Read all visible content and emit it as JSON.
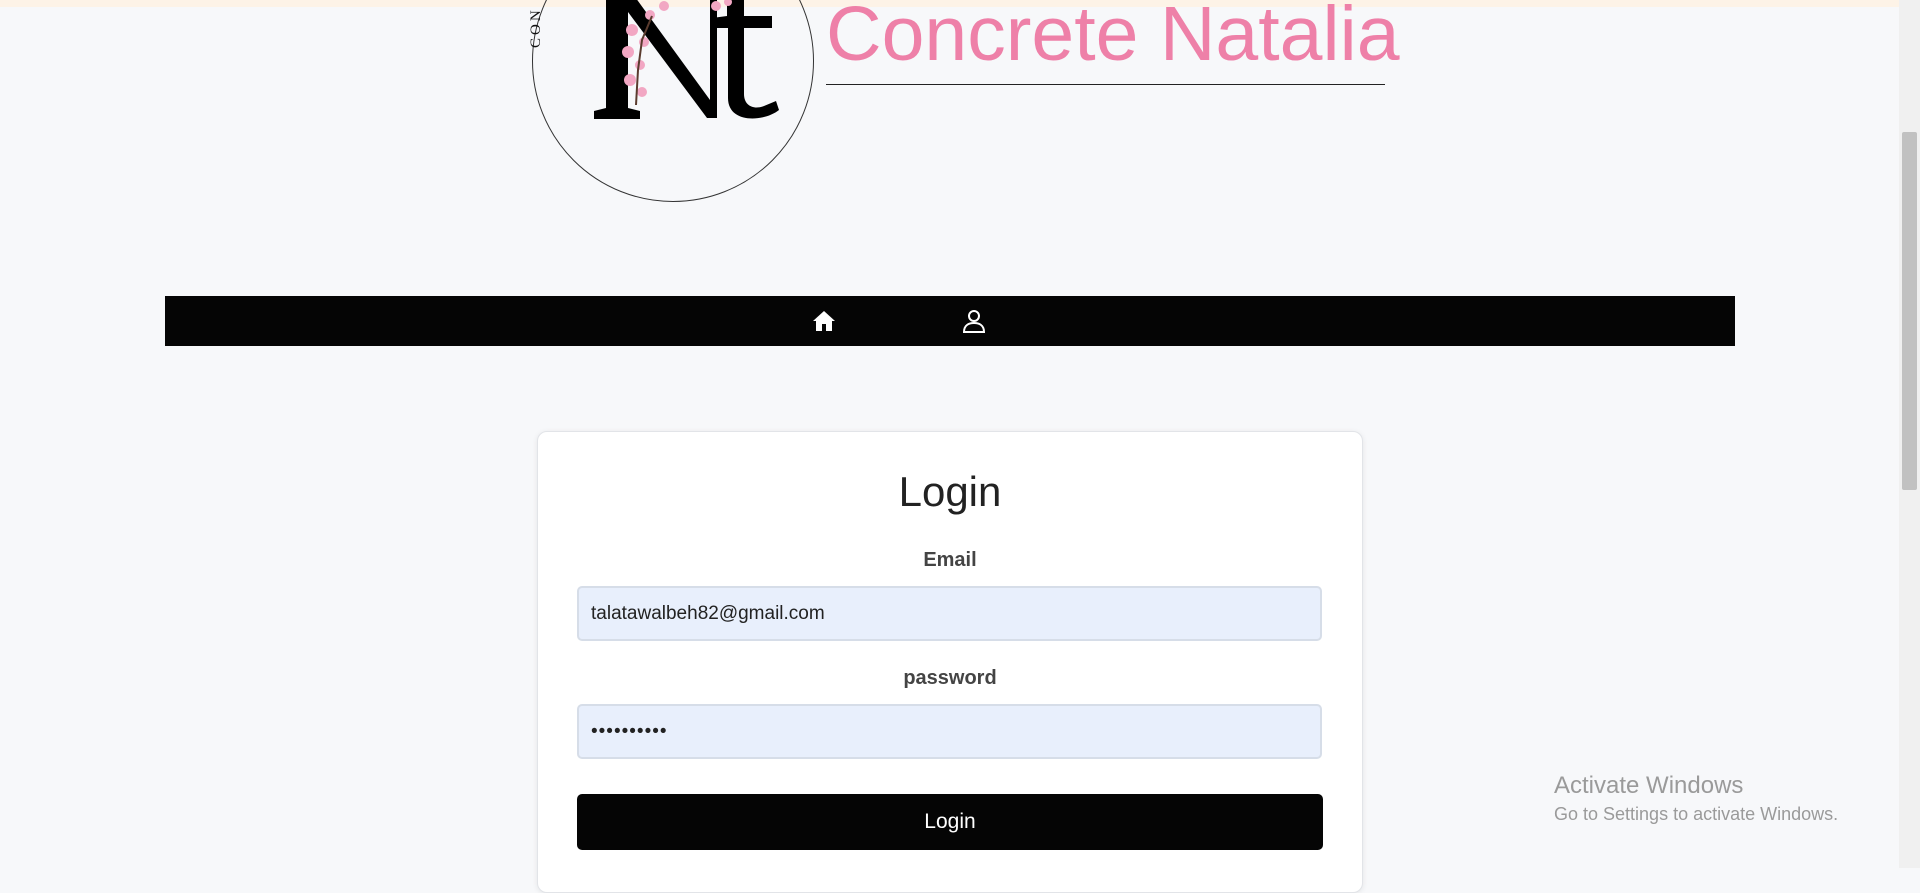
{
  "header": {
    "logo_text": "CON",
    "brand_title": "Concrete Natalia"
  },
  "nav": {
    "items": [
      {
        "icon": "home-icon"
      },
      {
        "icon": "user-icon"
      }
    ]
  },
  "login": {
    "title": "Login",
    "email_label": "Email",
    "email_value": "talatawalbeh82@gmail.com",
    "password_label": "password",
    "password_value": "••••••••••",
    "submit_label": "Login"
  },
  "watermark": {
    "title": "Activate Windows",
    "subtitle": "Go to Settings to activate Windows."
  },
  "colors": {
    "brand_pink": "#ee80a8",
    "nav_bg": "#050505",
    "input_bg": "#e8effc"
  }
}
